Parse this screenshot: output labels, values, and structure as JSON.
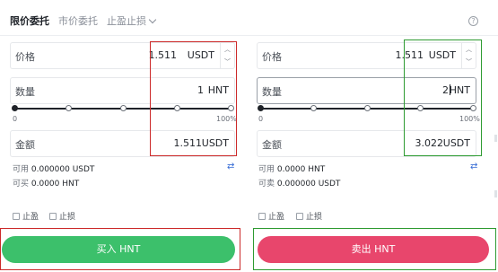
{
  "tabs": [
    "限价委托",
    "市价委托",
    "止盈止损"
  ],
  "left": {
    "price_label": "价格",
    "price_value": "1.511",
    "price_unit": "USDT",
    "qty_label": "数量",
    "qty_value": "1",
    "qty_unit": "HNT",
    "slider_min": "0",
    "slider_max": "100%",
    "slider_level": 0,
    "amount_label": "金额",
    "amount_value": "1.511",
    "amount_unit": "USDT",
    "avail_label": "可用",
    "avail_value": "0.000000 USDT",
    "can_label": "可买",
    "can_value": "0.0000 HNT",
    "tp_label": "止盈",
    "sl_label": "止损",
    "button_label": "买入 HNT"
  },
  "right": {
    "price_label": "价格",
    "price_value": "1.511",
    "price_unit": "USDT",
    "qty_label": "数量",
    "qty_value": "2",
    "qty_unit": "HNT",
    "slider_min": "0",
    "slider_max": "100%",
    "slider_level": 0,
    "amount_label": "金额",
    "amount_value": "3.022",
    "amount_unit": "USDT",
    "avail_label": "可用",
    "avail_value": "0.0000 HNT",
    "can_label": "可卖",
    "can_value": "0.000000 USDT",
    "tp_label": "止盈",
    "sl_label": "止损",
    "button_label": "卖出 HNT"
  },
  "icons": {
    "help": "help-circle-icon",
    "swap": "swap-arrows-icon",
    "stepper_up": "chevron-up-icon",
    "stepper_down": "chevron-down-icon"
  },
  "colors": {
    "buy": "#3cc06b",
    "sell": "#e8466c",
    "annotation_red": "#cc2a2a",
    "annotation_green": "#2e9b31",
    "link": "#3b6fd6"
  }
}
